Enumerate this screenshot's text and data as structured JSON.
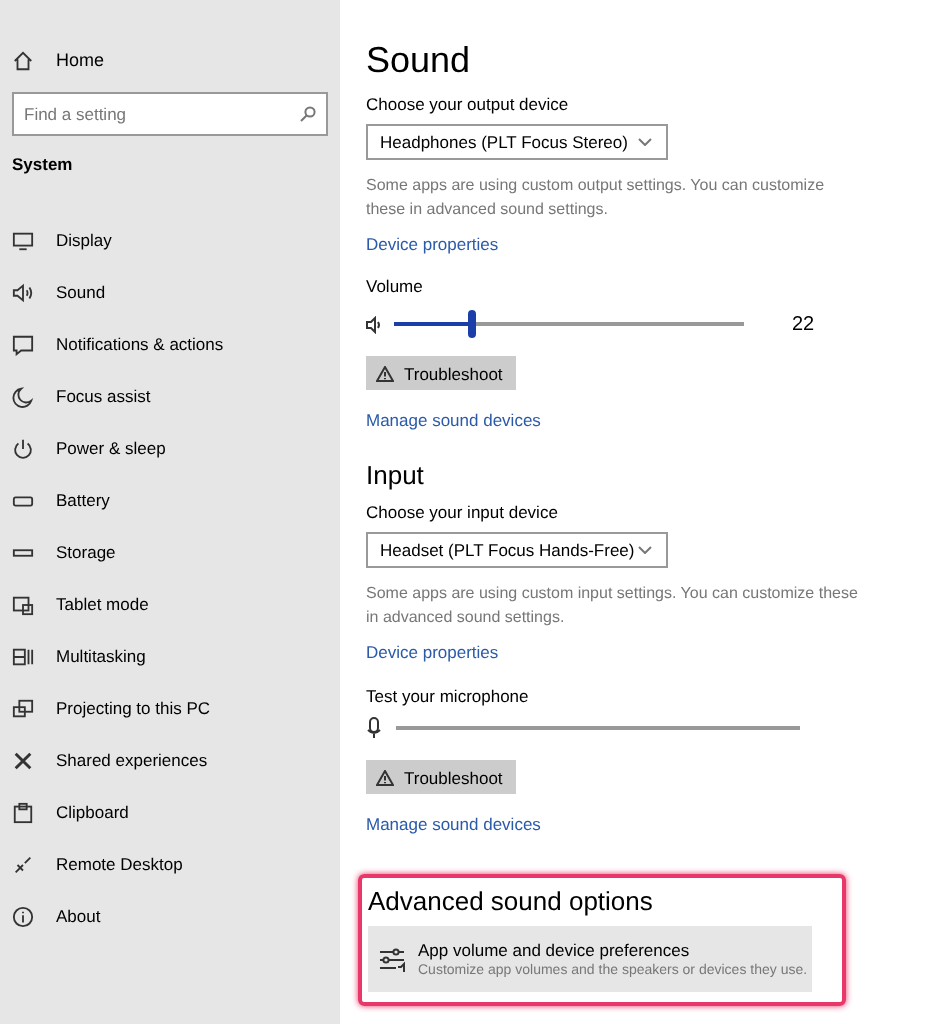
{
  "sidebar": {
    "home": "Home",
    "search": {
      "placeholder": "Find a setting"
    },
    "section": "System",
    "items": [
      {
        "label": "Display"
      },
      {
        "label": "Sound"
      },
      {
        "label": "Notifications & actions"
      },
      {
        "label": "Focus assist"
      },
      {
        "label": "Power & sleep"
      },
      {
        "label": "Battery"
      },
      {
        "label": "Storage"
      },
      {
        "label": "Tablet mode"
      },
      {
        "label": "Multitasking"
      },
      {
        "label": "Projecting to this PC"
      },
      {
        "label": "Shared experiences"
      },
      {
        "label": "Clipboard"
      },
      {
        "label": "Remote Desktop"
      },
      {
        "label": "About"
      }
    ]
  },
  "main": {
    "title": "Sound",
    "output": {
      "label": "Choose your output device",
      "device": "Headphones (PLT Focus Stereo)",
      "note": "Some apps are using custom output settings. You can customize these in advanced sound settings.",
      "properties_link": "Device properties",
      "volume_label": "Volume",
      "volume": {
        "level": 0.22,
        "reading": "22"
      },
      "troubleshoot": "Troubleshoot",
      "manage_link": "Manage sound devices"
    },
    "input": {
      "heading": "Input",
      "label": "Choose your input device",
      "device": "Headset (PLT Focus Hands-Free)",
      "note": "Some apps are using custom input settings. You can customize these in advanced sound settings.",
      "properties_link": "Device properties",
      "test_label": "Test your microphone",
      "troubleshoot": "Troubleshoot",
      "manage_link": "Manage sound devices"
    },
    "advanced": {
      "heading": "Advanced sound options",
      "item": {
        "title": "App volume and device preferences",
        "description": "Customize app volumes and the speakers or devices they use."
      }
    }
  }
}
